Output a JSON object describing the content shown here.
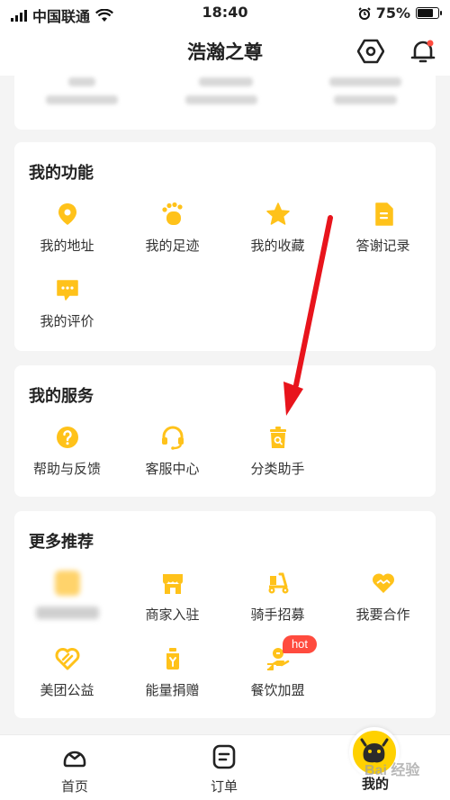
{
  "status_bar": {
    "carrier": "中国联通",
    "time": "18:40",
    "battery": "75%"
  },
  "header": {
    "title": "浩瀚之尊"
  },
  "colors": {
    "accent": "#ffc21a",
    "hot": "#ff4b3e",
    "arrow": "#e8141c"
  },
  "functions": {
    "title": "我的功能",
    "items": [
      {
        "label": "我的地址",
        "icon": "location-pin-icon"
      },
      {
        "label": "我的足迹",
        "icon": "footprint-icon"
      },
      {
        "label": "我的收藏",
        "icon": "star-icon"
      },
      {
        "label": "答谢记录",
        "icon": "document-icon"
      },
      {
        "label": "我的评价",
        "icon": "comment-icon"
      }
    ]
  },
  "services": {
    "title": "我的服务",
    "items": [
      {
        "label": "帮助与反馈",
        "icon": "help-icon"
      },
      {
        "label": "客服中心",
        "icon": "headset-icon"
      },
      {
        "label": "分类助手",
        "icon": "trash-bin-icon"
      }
    ]
  },
  "recommend": {
    "title": "更多推荐",
    "items": [
      {
        "label": "商家入驻",
        "icon": "storefront-icon"
      },
      {
        "label": "骑手招募",
        "icon": "scooter-icon"
      },
      {
        "label": "我要合作",
        "icon": "handshake-heart-icon"
      },
      {
        "label": "美团公益",
        "icon": "charity-heart-icon"
      },
      {
        "label": "能量捐赠",
        "icon": "energy-bottle-icon"
      },
      {
        "label": "餐饮加盟",
        "icon": "hand-coin-icon"
      }
    ],
    "hot_badge": "hot"
  },
  "bottom_nav": {
    "home": "首页",
    "orders": "订单",
    "mine": "我的"
  },
  "watermark": "Bai 经验"
}
